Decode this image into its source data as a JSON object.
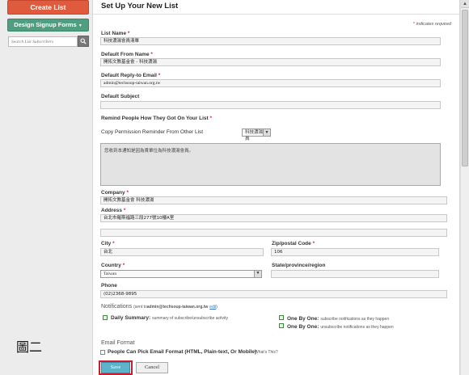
{
  "sidebar": {
    "create_list": "Create List",
    "design_signup": "Design Signup Forms",
    "design_signup_caret": "▼",
    "search_placeholder": "Search List Subscribers",
    "search_icon": "magnifier"
  },
  "figure_label": "圖二",
  "form": {
    "title": "Set Up Your New List",
    "required_note": "indicates required",
    "required_mark": "*",
    "list_name": {
      "label": "List Name",
      "value": "科技濃湯會員清單"
    },
    "default_from": {
      "label": "Default From Name",
      "value": "開拓文教基金會 - 科技濃湯"
    },
    "reply_to": {
      "label": "Default Reply-to Email",
      "value": "admin@techsoup-taiwan.org.tw"
    },
    "subject": {
      "label": "Default Subject",
      "value": ""
    },
    "remind": {
      "label": "Remind People How They Got On Your List"
    },
    "copy_perm": {
      "label": "Copy Permission Reminder From Other List",
      "value": "科技濃湯會員"
    },
    "reminder_text": "您收到本通知是因為貴單位為科技濃湯會員。",
    "company": {
      "label": "Company",
      "value": "開拓文教基金會 科技濃湯"
    },
    "address": {
      "label": "Address",
      "value": "台北市羅斯福路三段277號10樓A室",
      "value2": ""
    },
    "city": {
      "label": "City",
      "value": "台北"
    },
    "zip": {
      "label": "Zip/postal Code",
      "value": "106"
    },
    "country": {
      "label": "Country",
      "value": "Taiwan"
    },
    "state": {
      "label": "State/province/region",
      "value": ""
    },
    "phone": {
      "label": "Phone",
      "value": "(02)2368-9895"
    },
    "notifications": {
      "label": "Notifications",
      "sent_prefix": "(sent to",
      "email": "admin@techsoup-taiwan.org.tw",
      "edit": "edit",
      "sent_suffix": ")",
      "daily_label": "Daily Summary:",
      "daily_desc": "summary of subscribe/unsubscribe activity",
      "obo1_label": "One By One:",
      "obo1_desc": "subscribe notifications as they happen",
      "obo2_label": "One By One:",
      "obo2_desc": "unsubscribe notifications as they happen"
    },
    "email_format": {
      "label": "Email Format",
      "option": "People Can Pick Email Format (HTML, Plain-text, Or Mobile)",
      "whats_this": "What's This?",
      "info_icon": "i"
    },
    "save": "Save",
    "cancel": "Cancel"
  }
}
